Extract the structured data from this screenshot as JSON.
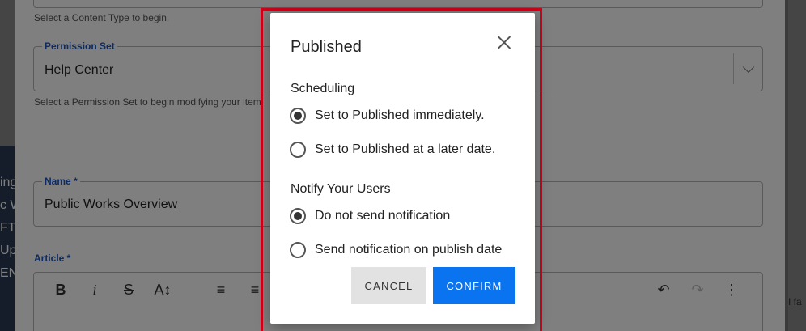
{
  "background_page": {
    "content_type_helper": "Select a Content Type to begin.",
    "permission_set": {
      "label": "Permission Set",
      "value": "Help Center",
      "helper": "Select a Permission Set to begin modifying your item"
    },
    "name_field": {
      "label": "Name *",
      "value": "Public Works Overview"
    },
    "article_label": "Article *",
    "left_edge_lines": [
      "ing",
      "c W",
      "FTI",
      "Up",
      "EN"
    ],
    "right_edge_text": "I fa",
    "toolbar_icons": [
      "bold-icon",
      "italic-icon",
      "strikethrough-icon",
      "font-size-icon",
      "align-left-icon",
      "align-center-icon",
      "undo-icon",
      "redo-icon",
      "more-icon"
    ]
  },
  "dialog": {
    "title": "Published",
    "scheduling": {
      "label": "Scheduling",
      "options": [
        {
          "label": "Set to Published immediately.",
          "checked": true
        },
        {
          "label": "Set to Published at a later date.",
          "checked": false
        }
      ]
    },
    "notify": {
      "label": "Notify Your Users",
      "options": [
        {
          "label": "Do not send notification",
          "checked": true
        },
        {
          "label": "Send notification on publish date",
          "checked": false
        }
      ]
    },
    "cancel_label": "CANCEL",
    "confirm_label": "CONFIRM"
  },
  "colors": {
    "highlight": "#d0021b",
    "confirm": "#0a74f0",
    "legend": "#1a56c4"
  }
}
